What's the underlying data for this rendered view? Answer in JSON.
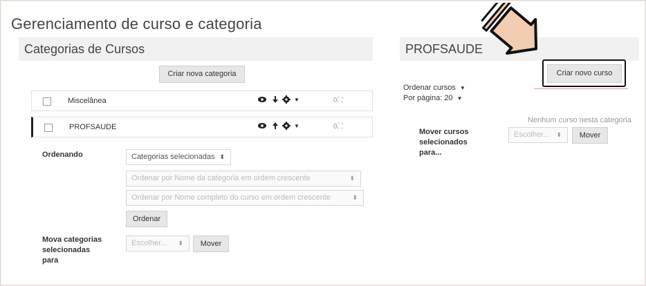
{
  "page": {
    "title": "Gerenciamento de curso e categoria"
  },
  "left_panel": {
    "heading": "Categorias de Cursos",
    "create_category_button": "Criar nova categoria",
    "categories": [
      {
        "name": "Miscelânea",
        "count": "0"
      },
      {
        "name": "PROFSAUDE",
        "count": "0"
      }
    ],
    "sorting": {
      "label": "Ordenando",
      "selected_option": "Categorias selecionadas",
      "sort_by_category_name": "Ordenar por Nome da categoria em ordem crescente",
      "sort_by_course_name": "Ordenar por Nome completo do curso em ordem crescente",
      "sort_button": "Ordenar"
    },
    "move": {
      "label": "Mova categorias selecionadas para",
      "choose_placeholder": "Escolher...",
      "move_button": "Mover"
    }
  },
  "right_panel": {
    "heading": "PROFSAUDE",
    "create_course_button": "Criar novo curso",
    "sort_courses": "Ordenar cursos",
    "per_page": "Por página: 20",
    "no_courses": "Nenhum curso nesta categoria",
    "move": {
      "label": "Mover cursos selecionados para...",
      "choose_placeholder": "Escolher...",
      "move_button": "Mover"
    }
  },
  "icons": {
    "visibility": "eye-icon",
    "move_down": "arrow-down-icon",
    "move_up": "arrow-up-icon",
    "settings": "gear-icon",
    "courses_count": "graduation-cap-icon",
    "pointer": "pointing-hand-icon"
  },
  "colors": {
    "panel_background": "#f1f1f1",
    "button_background": "#e7e7e7",
    "highlight_border": "#111111",
    "hand_fill": "#f3cdb1"
  }
}
